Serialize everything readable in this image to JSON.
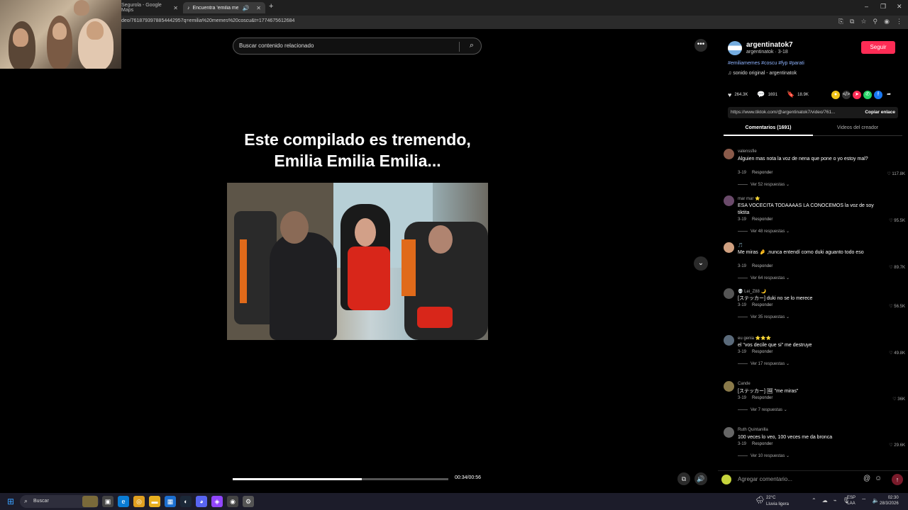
{
  "browser": {
    "tabs": [
      {
        "label": "Segurola - Google Maps",
        "active": false
      },
      {
        "label": "Encuentra 'emilia memes c",
        "active": true
      }
    ],
    "new_tab": "+",
    "url": "deo/7618793978854442957q=emilia%20memes%20coscu&t=1774675612684",
    "window_controls": [
      "–",
      "❐",
      "✕"
    ]
  },
  "video": {
    "search_placeholder": "Buscar contenido relacionado",
    "caption_line1": "Este compilado es tremendo,",
    "caption_line2": "Emilia Emilia Emilia...",
    "time": "00:34/00:56",
    "progress": 0.6
  },
  "post": {
    "username": "argentinatok7",
    "handle": "argentinatok · 3-18",
    "follow_label": "Seguir",
    "hashtags": "#emiliamemes #coscu #fyp #parati",
    "sound": "♫  sonido original - argentinatok",
    "likes": "264.3K",
    "comments": "1691",
    "saves": "18.9K",
    "link": "https://www.tiktok.com/@argentinatok7/video/761...",
    "copy_label": "Copiar enlace",
    "tab_comments": "Comentarios (1691)",
    "tab_creator": "Videos del creador"
  },
  "comments": [
    {
      "author": "valenssfie",
      "text": "Alguien mas nota la voz de nena que pone o yo estoy mal?",
      "date": "3-19",
      "reply": "Responder",
      "likes": "♡ 117.8K",
      "replies": "Ver 52 respuestas ⌄",
      "avatar_color": "#8a5a4a"
    },
    {
      "author": "mar mar ⭐",
      "text": "ESA VOCECITA TODAAAAS LA CONOCEMOS la voz de soy tiktita",
      "date": "3-19",
      "reply": "Responder",
      "likes": "♡ 95.5K",
      "replies": "Ver 48 respuestas ⌄",
      "avatar_color": "#6a4a6a"
    },
    {
      "author": "🎵",
      "text": "Me miras 🤌 ,nunca entendí como duki aguanto todo eso",
      "date": "3-19",
      "reply": "Responder",
      "likes": "♡ 89.7K",
      "replies": "Ver 64 respuestas ⌄",
      "avatar_color": "#d0a080"
    },
    {
      "author": "💀 Lei_Z88 🌙",
      "text": "[ステッカー] duki no se lo merece",
      "date": "3-19",
      "reply": "Responder",
      "likes": "♡ 56.5K",
      "replies": "Ver 35 respuestas ⌄",
      "avatar_color": "#555"
    },
    {
      "author": "eu genia ⭐⭐⭐",
      "text": "el \"vos decile que si\" me destruye",
      "date": "3-19",
      "reply": "Responder",
      "likes": "♡ 49.8K",
      "replies": "Ver 17 respuestas ⌄",
      "avatar_color": "#5a6a7a"
    },
    {
      "author": "Cande",
      "text": "[ステッカー] 🖼 \"me miras\"",
      "date": "3-19",
      "reply": "Responder",
      "likes": "♡ 36K",
      "replies": "Ver 7 respuestas ⌄",
      "avatar_color": "#8a7a4a"
    },
    {
      "author": "Ruth Quintanilla",
      "text": "100 veces lo veo, 100 veces me da bronca",
      "date": "3-19",
      "reply": "Responder",
      "likes": "♡ 29.6K",
      "replies": "Ver 10 respuestas ⌄",
      "avatar_color": "#666"
    }
  ],
  "compose": {
    "placeholder": "Agregar comentario...",
    "at": "@",
    "emoji": "☺",
    "send": "↑"
  },
  "taskbar": {
    "search_label": "Buscar",
    "weather_temp": "22°C",
    "weather_desc": "Lluvia ligera",
    "lang1": "ESP",
    "lang2": "LAA",
    "time": "02:30",
    "date": "28/3/2026"
  }
}
